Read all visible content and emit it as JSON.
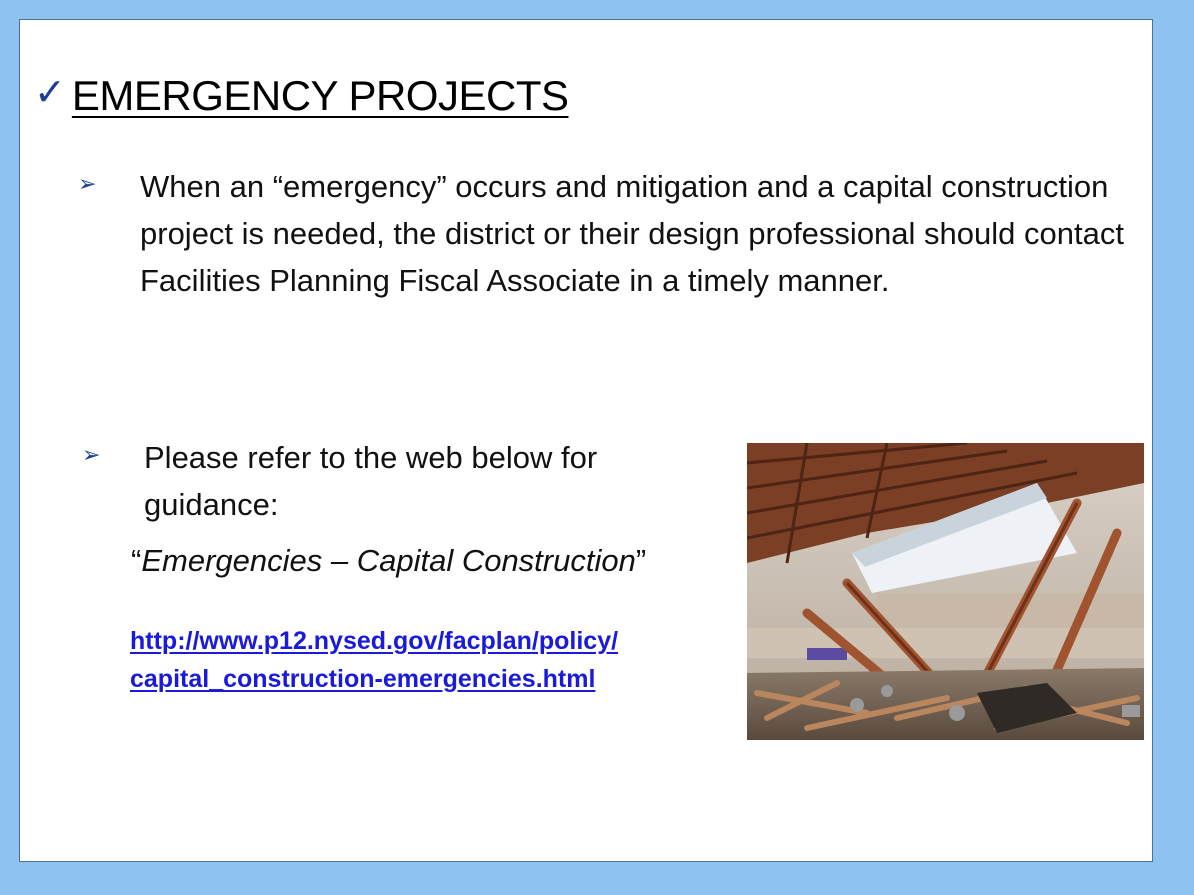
{
  "slide": {
    "title_check": "✓",
    "title": "EMERGENCY PROJECTS",
    "bullet_marker": "➢",
    "bullets": [
      "When an “emergency” occurs and mitigation and a capital construction project is needed, the district or their design professional should contact Facilities Planning Fiscal Associate in a timely manner.",
      "Please refer to the web below for guidance:"
    ],
    "quote_open": "“",
    "quote_text": "Emergencies – Capital Construction",
    "quote_close": "”",
    "link_line1": "http://www.p12.nysed.gov/facplan/policy/",
    "link_line2": "capital_construction-emergencies.html"
  },
  "colors": {
    "frame": "#8ec3f0",
    "accent": "#1d3f95",
    "link": "#1a1adb"
  },
  "icons": [
    "checkmark-icon",
    "arrow-bullet-icon"
  ]
}
